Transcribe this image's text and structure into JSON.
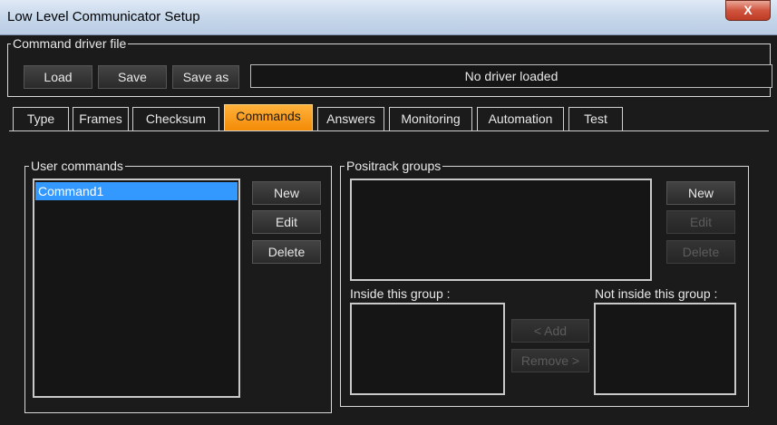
{
  "window": {
    "title": "Low Level Communicator Setup",
    "close_glyph": "X"
  },
  "driver": {
    "frame_label": "Command driver file",
    "load_label": "Load",
    "save_label": "Save",
    "saveas_label": "Save as",
    "status_text": "No driver loaded"
  },
  "tabs": [
    {
      "label": "Type"
    },
    {
      "label": "Frames"
    },
    {
      "label": "Checksum"
    },
    {
      "label": "Commands"
    },
    {
      "label": "Answers"
    },
    {
      "label": "Monitoring"
    },
    {
      "label": "Automation"
    },
    {
      "label": "Test"
    }
  ],
  "active_tab": "Commands",
  "user_commands": {
    "frame_label": "User commands",
    "items": [
      "Command1"
    ],
    "selected": "Command1",
    "new_label": "New",
    "edit_label": "Edit",
    "delete_label": "Delete"
  },
  "positrack": {
    "frame_label": "Positrack groups",
    "new_label": "New",
    "edit_label": "Edit",
    "delete_label": "Delete",
    "inside_label": "Inside this group :",
    "not_inside_label": "Not inside this group :",
    "add_label": "< Add",
    "remove_label": "Remove >"
  },
  "colors": {
    "accent": "#f38a05",
    "selection": "#3399ff",
    "background": "#1b1b1b"
  }
}
